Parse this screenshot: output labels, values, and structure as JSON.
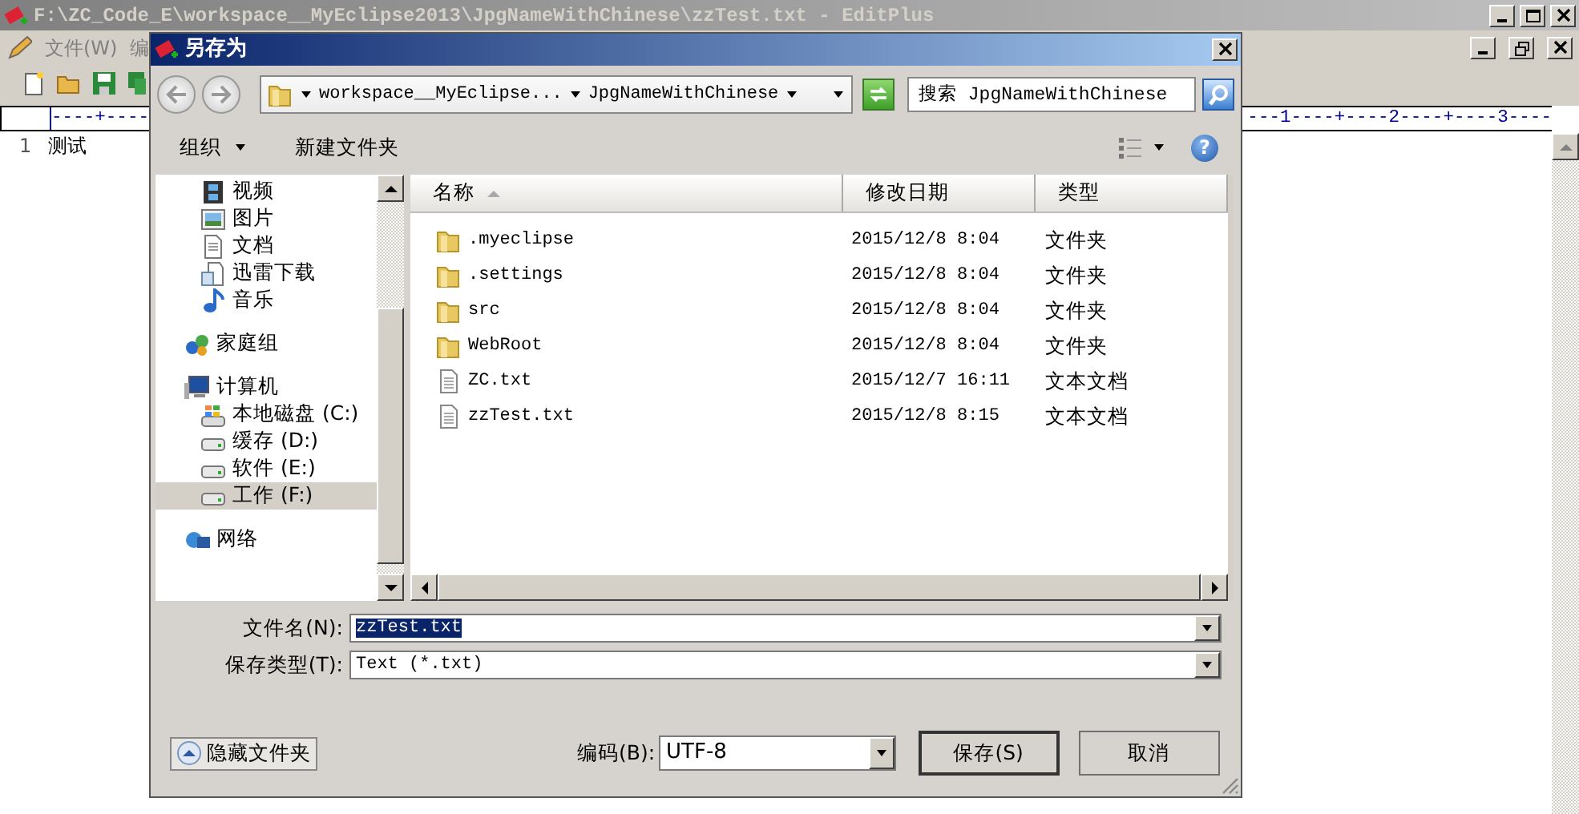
{
  "app": {
    "title": "F:\\ZC_Code_E\\workspace__MyEclipse2013\\JpgNameWithChinese\\zzTest.txt - EditPlus",
    "menu": [
      "文件(W)",
      "编"
    ],
    "toolbar": [
      {
        "kind": "new"
      },
      {
        "kind": "open"
      },
      {
        "kind": "save"
      },
      {
        "kind": "saveall"
      }
    ],
    "ruler_left": "----+----",
    "ruler_right": "---1----+----2----+----3----",
    "lines": [
      {
        "number": "1",
        "text": "测试"
      }
    ]
  },
  "dialog": {
    "title": "另存为",
    "breadcrumbs": [
      "workspace__MyEclipse...",
      "JpgNameWithChinese"
    ],
    "search": {
      "placeholder": "搜索 JpgNameWithChinese"
    },
    "organize": "组织",
    "new_folder": "新建文件夹",
    "help": "?",
    "nav": [
      {
        "children": [
          {
            "label": "视频",
            "kind": "video",
            "selected": false
          },
          {
            "label": "图片",
            "kind": "pictures",
            "selected": false
          },
          {
            "label": "文档",
            "kind": "docs",
            "selected": false
          },
          {
            "label": "迅雷下载",
            "kind": "download",
            "selected": false
          },
          {
            "label": "音乐",
            "kind": "music",
            "selected": false
          }
        ]
      },
      {
        "label": "家庭组",
        "kind": "homegroup",
        "selected": false
      },
      {
        "label": "计算机",
        "kind": "computer",
        "selected": false,
        "children": [
          {
            "label": "本地磁盘 (C:)",
            "kind": "systemdrive",
            "selected": false
          },
          {
            "label": "缓存 (D:)",
            "kind": "drive",
            "selected": false
          },
          {
            "label": "软件 (E:)",
            "kind": "drive",
            "selected": false
          },
          {
            "label": "工作 (F:)",
            "kind": "drive",
            "selected": true
          }
        ]
      },
      {
        "label": "网络",
        "kind": "network",
        "selected": false
      }
    ],
    "columns": [
      {
        "label": "名称",
        "sorted": true
      },
      {
        "label": "修改日期",
        "sorted": false
      },
      {
        "label": "类型",
        "sorted": false
      }
    ],
    "files": [
      {
        "name": ".myeclipse",
        "date": "2015/12/8 8:04",
        "type": "文件夹",
        "kind": "folder"
      },
      {
        "name": ".settings",
        "date": "2015/12/8 8:04",
        "type": "文件夹",
        "kind": "folder"
      },
      {
        "name": "src",
        "date": "2015/12/8 8:04",
        "type": "文件夹",
        "kind": "folder"
      },
      {
        "name": "WebRoot",
        "date": "2015/12/8 8:04",
        "type": "文件夹",
        "kind": "folder"
      },
      {
        "name": "ZC.txt",
        "date": "2015/12/7 16:11",
        "type": "文本文档",
        "kind": "text"
      },
      {
        "name": "zzTest.txt",
        "date": "2015/12/8 8:15",
        "type": "文本文档",
        "kind": "text"
      }
    ],
    "file_name": {
      "label": "文件名(N):",
      "value": "zzTest.txt",
      "text_selected": true
    },
    "file_type": {
      "label": "保存类型(T):",
      "value": "Text (*.txt)"
    },
    "hide_folders": "隐藏文件夹",
    "encoding": {
      "label": "编码(B):",
      "value": "UTF-8"
    },
    "save": "保存(S)",
    "cancel": "取消"
  }
}
